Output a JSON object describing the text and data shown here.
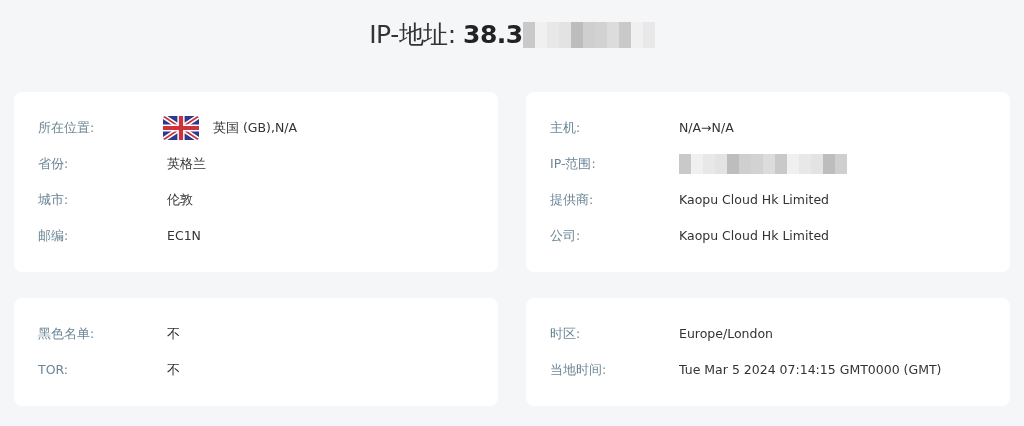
{
  "title": {
    "text": "IP-地址: **38.3**",
    "redacted": true
  },
  "cards": [
    {
      "rows": [
        {
          "label": "所在位置:",
          "kind": "flag",
          "value": "英国 (GB),N/A"
        },
        {
          "label": "省份:",
          "kind": "text",
          "value": "英格兰"
        },
        {
          "label": "城市:",
          "kind": "text",
          "value": "伦敦"
        },
        {
          "label": "邮编:",
          "kind": "text",
          "value": "EC1N"
        }
      ]
    },
    {
      "rows": [
        {
          "label": "主机:",
          "kind": "text",
          "value": "N/A→N/A"
        },
        {
          "label": "IP-范围:",
          "kind": "redacted"
        },
        {
          "label": "提供商:",
          "kind": "text",
          "value": "Kaopu Cloud Hk Limited"
        },
        {
          "label": "公司:",
          "kind": "text",
          "value": "Kaopu Cloud Hk Limited"
        }
      ]
    },
    {
      "rows": [
        {
          "label": "黑色名单:",
          "kind": "text",
          "value": "不"
        },
        {
          "label": "TOR:",
          "kind": "text",
          "value": "不"
        }
      ]
    },
    {
      "rows": [
        {
          "label": "时区:",
          "kind": "text",
          "value": "Europe/London"
        },
        {
          "label": "当地时间:",
          "kind": "text",
          "value": "Tue Mar 5 2024 07:14:15 GMT0000 (GMT)"
        }
      ]
    }
  ]
}
